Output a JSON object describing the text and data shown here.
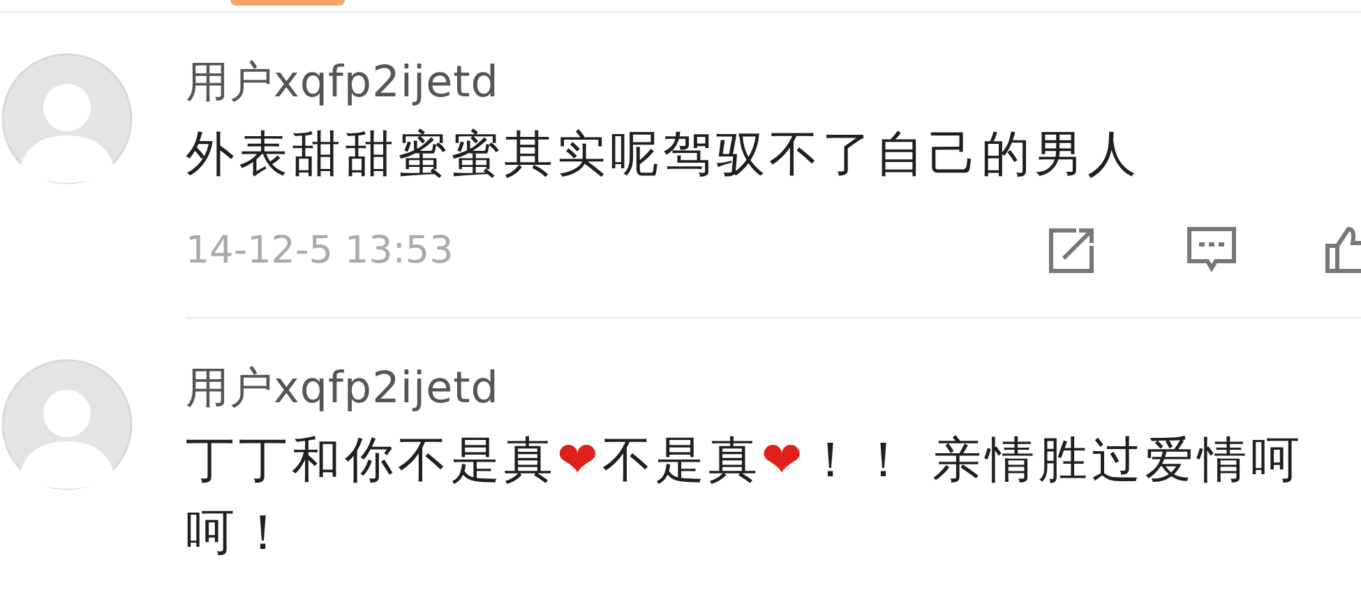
{
  "comments": [
    {
      "user": "用户xqfp2ijetd",
      "content": [
        {
          "kind": "text",
          "text": "外表甜甜蜜蜜其实呢驾驭不了自己的男人"
        }
      ],
      "time": "14-12-5 13:53"
    },
    {
      "user": "用户xqfp2ijetd",
      "content": [
        {
          "kind": "text",
          "text": "丁丁和你不是真"
        },
        {
          "kind": "emoji",
          "text": "❤"
        },
        {
          "kind": "text",
          "text": "不是真"
        },
        {
          "kind": "emoji",
          "text": "❤"
        },
        {
          "kind": "text",
          "text": "！！ 亲情胜过爱情呵呵！"
        }
      ]
    }
  ]
}
